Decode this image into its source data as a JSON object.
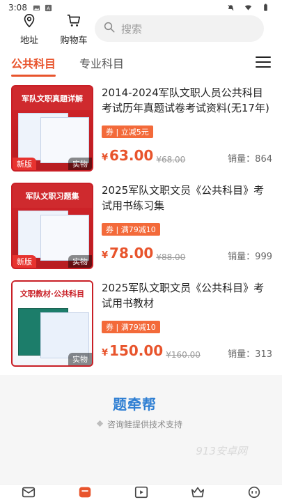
{
  "status": {
    "time": "3:08"
  },
  "top": {
    "address_label": "地址",
    "cart_label": "购物车",
    "search_placeholder": "搜索"
  },
  "tabs": [
    {
      "label": "公共科目",
      "active": true
    },
    {
      "label": "专业科目",
      "active": false
    }
  ],
  "products": [
    {
      "cover_lines": [
        "军队文职真题详解"
      ],
      "stamp": "新版",
      "kind": "实物",
      "title": "2014-2024军队文职人员公共科目考试历年真题试卷考试资料(无17年)",
      "coupon": "券 | 立减5元",
      "price": "63.00",
      "old_price": "¥68.00",
      "sales": "销量：864"
    },
    {
      "cover_lines": [
        "军队文职习题集"
      ],
      "stamp": "新版",
      "kind": "实物",
      "title": "2025军队文职文员《公共科目》考试用书练习集",
      "coupon": "券 | 满79减10",
      "price": "78.00",
      "old_price": "¥88.00",
      "sales": "销量：999"
    },
    {
      "cover_lines": [
        "文职教材·公共科目"
      ],
      "stamp": "",
      "kind": "实物",
      "title": "2025军队文职文员《公共科目》考试用书教材",
      "coupon": "券 | 满79减10",
      "price": "150.00",
      "old_price": "¥160.00",
      "sales": "销量：313"
    }
  ],
  "footer": {
    "brand": "题牵帮",
    "support": "咨询鲑提供技术支持",
    "watermark": "913安卓网"
  },
  "colors": {
    "accent": "#e8542c",
    "coupon": "#f36a3a",
    "brand": "#2f7fd3"
  }
}
